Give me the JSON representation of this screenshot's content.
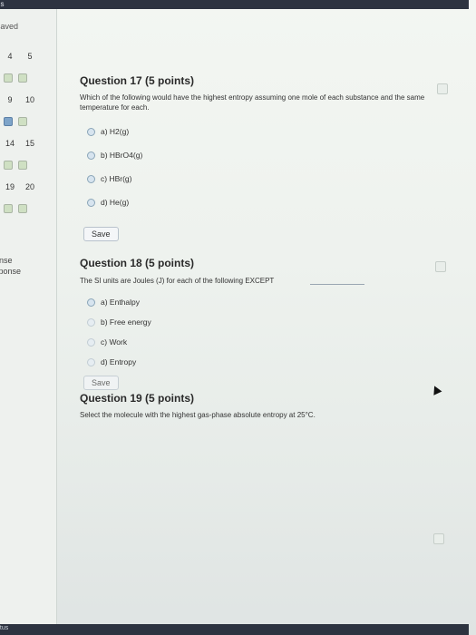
{
  "header": {
    "top_label": "ns",
    "status_label": "saved"
  },
  "sidebar": {
    "rows": [
      {
        "a": "4",
        "b": "5"
      },
      {
        "a": "9",
        "b": "10"
      },
      {
        "a": "14",
        "b": "15"
      },
      {
        "a": "19",
        "b": "20"
      }
    ],
    "section_labels": [
      "onse",
      "sponse"
    ],
    "footer_label": "ntus"
  },
  "q17": {
    "title": "Question 17 (5 points)",
    "text_line1": "Which of the following would have the highest entropy assuming one mole of each substance and the same",
    "text_line2": "temperature for each.",
    "options": [
      "a) H2(g)",
      "b) HBrO4(g)",
      "c) HBr(g)",
      "d) He(g)"
    ],
    "save_label": "Save"
  },
  "q18": {
    "title": "Question 18 (5 points)",
    "text": "The SI units are Joules (J) for each of the following EXCEPT",
    "options": [
      "a) Enthalpy",
      "b) Free energy",
      "c) Work",
      "d) Entropy"
    ],
    "save_label": "Save"
  },
  "q19": {
    "title": "Question 19 (5 points)",
    "text": "Select the molecule with the highest gas-phase absolute entropy at 25°C."
  }
}
